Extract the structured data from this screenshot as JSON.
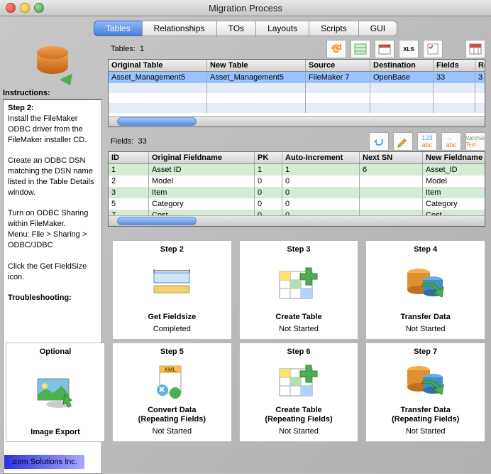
{
  "window": {
    "title": "Migration Process"
  },
  "tabs": [
    "Tables",
    "Relationships",
    "TOs",
    "Layouts",
    "Scripts",
    "GUI"
  ],
  "active_tab": 0,
  "instructions": {
    "header": "Instructions:",
    "step_label": "Step 2",
    "body_html": "Install the FileMaker ODBC driver from the FileMaker installer CD.\n\nCreate an ODBC DSN matching the DSN name listed in the Table Details window.\n\nTurn on ODBC Sharing within FileMaker.\nMenu: File > Sharing > ODBC/JDBC\n\nClick the Get FieldSize icon.",
    "trouble_label": "Troubleshooting"
  },
  "tables_section": {
    "label": "Tables:",
    "count": "1",
    "columns": [
      "Original Table",
      "New Table",
      "Source",
      "Destination",
      "Fields",
      "Records"
    ],
    "rows": [
      {
        "sel": true,
        "cells": [
          "Asset_Management5",
          "Asset_Management5",
          "FileMaker 7",
          "OpenBase",
          "33",
          "3"
        ]
      }
    ]
  },
  "fields_section": {
    "label": "Fields:",
    "count": "33",
    "columns": [
      "ID",
      "Original Fieldname",
      "PK",
      "Auto-Increment",
      "Next SN",
      "New Fieldname"
    ],
    "rows": [
      {
        "alt": true,
        "cells": [
          "1",
          "Asset ID",
          "1",
          "1",
          "6",
          "Asset_ID"
        ]
      },
      {
        "alt": false,
        "cells": [
          "2",
          "Model",
          "0",
          "0",
          "",
          "Model"
        ]
      },
      {
        "alt": true,
        "cells": [
          "3",
          "Item",
          "0",
          "0",
          "",
          "Item"
        ]
      },
      {
        "alt": false,
        "cells": [
          "5",
          "Category",
          "0",
          "0",
          "",
          "Category"
        ]
      },
      {
        "alt": true,
        "cells": [
          "7",
          "Cost",
          "0",
          "0",
          "",
          "Cost"
        ]
      }
    ]
  },
  "step_cards_top": [
    {
      "title": "Step 2",
      "label": "Get Fieldsize",
      "status": "Completed",
      "icon": "ruler"
    },
    {
      "title": "Step 3",
      "label": "Create Table",
      "status": "Not Started",
      "icon": "table-plus"
    },
    {
      "title": "Step 4",
      "label": "Transfer Data",
      "status": "Not Started",
      "icon": "db-arrow"
    }
  ],
  "step_cards_bot": [
    {
      "title": "Step 5",
      "label": "Convert Data\n(Repeating Fields)",
      "status": "Not Started",
      "icon": "xml"
    },
    {
      "title": "Step 6",
      "label": "Create Table\n(Repeating Fields)",
      "status": "Not Started",
      "icon": "table-plus"
    },
    {
      "title": "Step 7",
      "label": "Transfer Data\n(Repeating Fields)",
      "status": "Not Started",
      "icon": "db-arrow"
    }
  ],
  "optional_card": {
    "title": "Optional",
    "label": "Image Export"
  },
  "footer": ".com Solutions Inc."
}
